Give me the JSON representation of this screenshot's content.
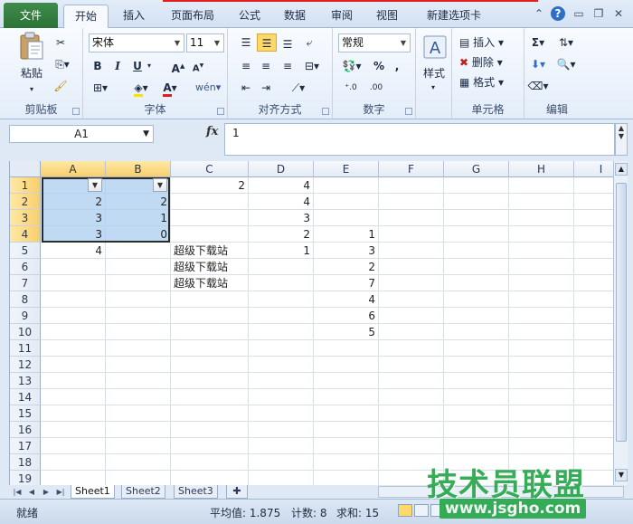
{
  "tabs": {
    "file": "文件",
    "home": "开始",
    "insert": "插入",
    "layout": "页面布局",
    "formulas": "公式",
    "data": "数据",
    "review": "审阅",
    "view": "视图",
    "custom": "新建选项卡"
  },
  "ribbon": {
    "clipboard": {
      "label": "剪贴板",
      "paste": "粘贴"
    },
    "font": {
      "label": "字体",
      "font_name": "宋体",
      "font_size": "11",
      "bold": "B",
      "italic": "I",
      "underline": "U"
    },
    "alignment": {
      "label": "对齐方式"
    },
    "number": {
      "label": "数字",
      "format": "常规",
      "percent": "%",
      "comma": ","
    },
    "styles": {
      "label": "样式"
    },
    "cells": {
      "label": "单元格",
      "insert": "插入",
      "delete": "删除",
      "format": "格式"
    },
    "editing": {
      "label": "编辑"
    }
  },
  "formula_bar": {
    "name_box": "A1",
    "fx": "fx",
    "content": "1"
  },
  "grid": {
    "columns": [
      "A",
      "B",
      "C",
      "D",
      "E",
      "F",
      "G",
      "H",
      "I"
    ],
    "rows": [
      "1",
      "2",
      "3",
      "4",
      "5",
      "6",
      "7",
      "8",
      "9",
      "10",
      "11",
      "12",
      "13",
      "14",
      "15",
      "16",
      "17",
      "18",
      "19"
    ],
    "cells": {
      "C1": "2",
      "D1": "4",
      "A2": "2",
      "B2": "2",
      "D2": "4",
      "A3": "3",
      "B3": "1",
      "D3": "3",
      "A4": "3",
      "B4": "0",
      "D4": "2",
      "E4": "1",
      "A5": "4",
      "C5": "超级下载站",
      "D5": "1",
      "E5": "3",
      "C6": "超级下载站",
      "E6": "2",
      "C7": "超级下载站",
      "E7": "7",
      "E8": "4",
      "E9": "6",
      "E10": "5"
    }
  },
  "sheets": [
    "Sheet1",
    "Sheet2",
    "Sheet3"
  ],
  "active_sheet": "Sheet1",
  "status": {
    "ready": "就绪",
    "average": "平均值: 1.875",
    "count": "计数: 8",
    "sum": "求和: 15"
  },
  "watermark": {
    "title": "技术员联盟",
    "url": "www.jsgho.com"
  },
  "colors": {
    "file_tab": "#2b7337",
    "selection": "#accdf0",
    "header_selected": "#f9cf6c",
    "watermark": "#27a74a"
  }
}
